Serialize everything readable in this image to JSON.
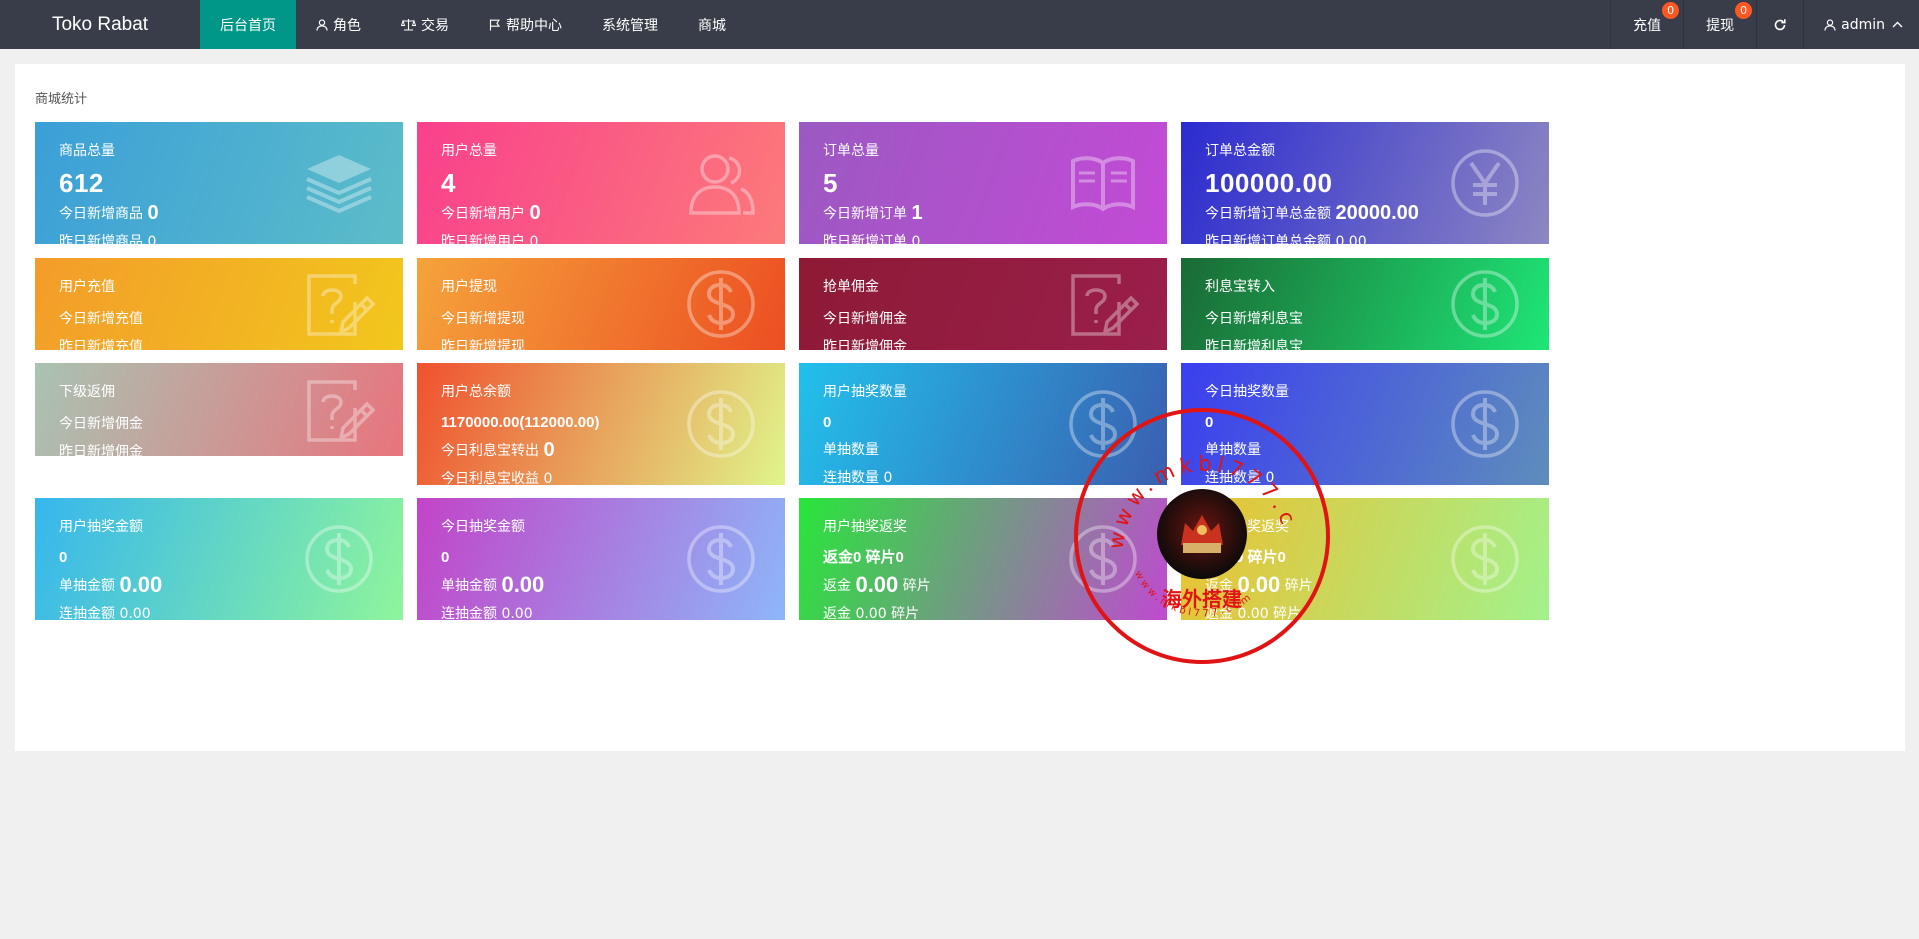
{
  "app": {
    "logo": "Toko Rabat"
  },
  "nav": [
    {
      "label": "后台首页",
      "icon": "",
      "active": true
    },
    {
      "label": "角色",
      "icon": "user-icon"
    },
    {
      "label": "交易",
      "icon": "scale-icon"
    },
    {
      "label": "帮助中心",
      "icon": "flag-icon"
    },
    {
      "label": "系统管理",
      "icon": ""
    },
    {
      "label": "商城",
      "icon": ""
    }
  ],
  "right_nav": {
    "recharge": {
      "label": "充值",
      "badge": "0"
    },
    "withdraw": {
      "label": "提现",
      "badge": "0"
    },
    "refresh_icon": "refresh-icon",
    "user": {
      "label": "admin",
      "icon": "user-icon",
      "caret": "chevron-up-icon"
    }
  },
  "panel": {
    "title": "商城统计"
  },
  "cards": [
    {
      "label": "商品总量",
      "big": "612",
      "l1": "今日新增商品",
      "l1v": "0",
      "l2": "昨日新增商品",
      "l2v": "0",
      "icon": "layers-icon",
      "gradient": [
        "#3b9fd8",
        "#5cbdc8"
      ]
    },
    {
      "label": "用户总量",
      "big": "4",
      "l1": "今日新增用户",
      "l1v": "0",
      "l2": "昨日新增用户",
      "l2v": "0",
      "icon": "users-icon",
      "gradient": [
        "#f9408c",
        "#fc7a7a"
      ]
    },
    {
      "label": "订单总量",
      "big": "5",
      "l1": "今日新增订单",
      "l1v": "1",
      "l2": "昨日新增订单",
      "l2v": "0",
      "icon": "book-icon",
      "gradient": [
        "#9b59c2",
        "#c44ad6"
      ]
    },
    {
      "label": "订单总金额",
      "big": "100000.00",
      "l1": "今日新增订单总金额",
      "l1v": "20000.00",
      "l2": "昨日新增订单总金额",
      "l2v": "0.00",
      "icon": "yen-icon",
      "gradient": [
        "#2b2bd0",
        "#8d87c2"
      ]
    },
    {
      "label": "用户充值",
      "l1": "今日新增充值",
      "l2": "昨日新增充值",
      "icon": "edit-question-icon",
      "gradient": [
        "#f39c2a",
        "#f2c71c"
      ]
    },
    {
      "label": "用户提现",
      "l1": "今日新增提现",
      "l2": "昨日新增提现",
      "icon": "dollar-icon",
      "gradient": [
        "#f5a33b",
        "#ec4f22"
      ]
    },
    {
      "label": "抢单佣金",
      "l1": "今日新增佣金",
      "l2": "昨日新增佣金",
      "icon": "edit-question-icon",
      "gradient": [
        "#8d1a35",
        "#9a1f4c"
      ]
    },
    {
      "label": "利息宝转入",
      "l1": "今日新增利息宝",
      "l2": "昨日新增利息宝",
      "icon": "dollar-icon",
      "gradient": [
        "#1a6a34",
        "#1ee676"
      ]
    },
    {
      "label": "下级返佣",
      "l1": "今日新增佣金",
      "l2": "昨日新增佣金",
      "icon": "edit-question-icon",
      "gradient": [
        "#a9c3b2",
        "#e8747d"
      ]
    },
    {
      "label": "用户总余额",
      "small": "1170000.00(112000.00)",
      "l1": "今日利息宝转出",
      "l1v": "0",
      "l2": "今日利息宝收益",
      "l2v": "0",
      "icon": "dollar-icon",
      "gradient": [
        "#f0512f",
        "#e0f58a"
      ]
    },
    {
      "label": "用户抽奖数量",
      "small": "0",
      "l1": "单抽数量",
      "l2": "连抽数量",
      "l2v": "0",
      "icon": "dollar-icon",
      "gradient": [
        "#22c0ec",
        "#3a5fb0"
      ]
    },
    {
      "label": "今日抽奖数量",
      "small": "0",
      "l1": "单抽数量",
      "l2": "连抽数量",
      "l2v": "0",
      "icon": "dollar-icon",
      "gradient": [
        "#3b3ef0",
        "#5e8dbc"
      ]
    },
    {
      "label": "用户抽奖金额",
      "small": "0",
      "l1": "单抽金额",
      "l1v": "0.00",
      "l2": "连抽金额",
      "l2v": "0.00",
      "icon": "dollar-icon",
      "gradient": [
        "#36b6ee",
        "#8ef59c"
      ]
    },
    {
      "label": "今日抽奖金额",
      "small": "0",
      "l1": "单抽金额",
      "l1v": "0.00",
      "l2": "连抽金额",
      "l2v": "0.00",
      "icon": "dollar-icon",
      "gradient": [
        "#c244c8",
        "#8eb6f8"
      ]
    },
    {
      "label": "用户抽奖返奖",
      "small": "返金0 碎片0",
      "l1": "返金",
      "l1v": "0.00",
      "l1s": "碎片",
      "l2": "返金",
      "l2v": "0.00",
      "l2s": "碎片",
      "icon": "dollar-icon",
      "gradient": [
        "#28e63a",
        "#c04ad0"
      ]
    },
    {
      "label": "今日抽奖返奖",
      "small": "返金0 碎片0",
      "l1": "返金",
      "l1v": "0.00",
      "l1s": "碎片",
      "l2": "返金",
      "l2v": "0.00",
      "l2s": "碎片",
      "icon": "dollar-icon",
      "gradient": [
        "#ecc030",
        "#a2f28c"
      ]
    }
  ],
  "stamp": {
    "url_top": "www.mkbl777.com",
    "url_bottom": "www.mkbl777.com",
    "text": "海外搭建",
    "color": "#e01414"
  }
}
